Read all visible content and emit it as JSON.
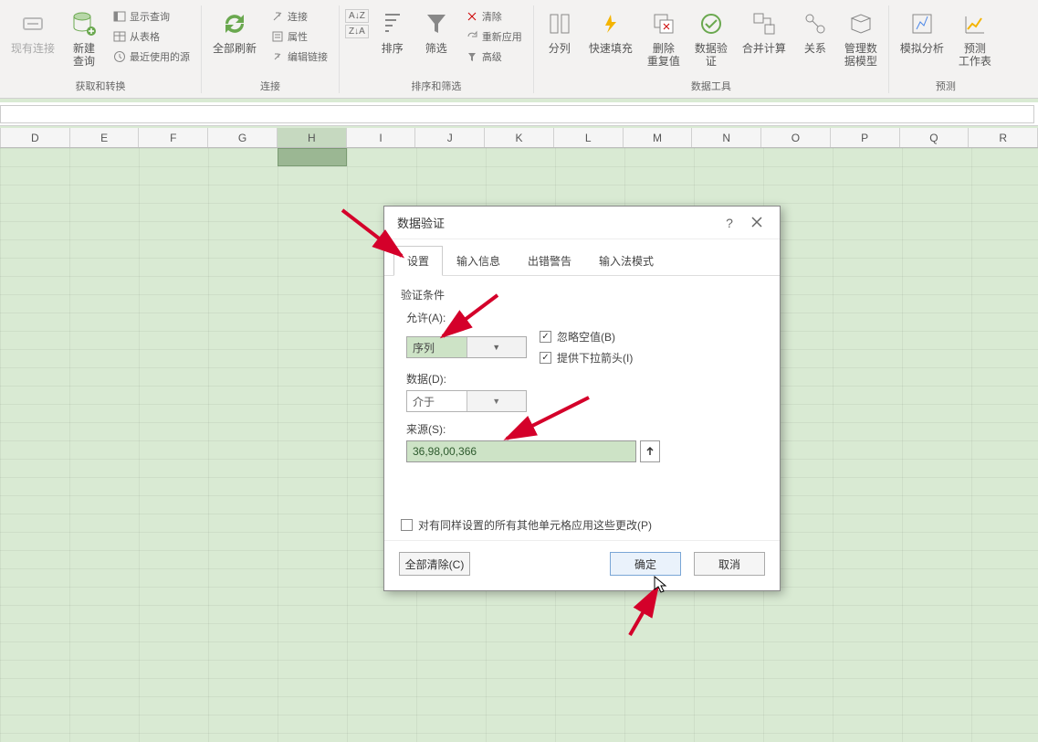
{
  "ribbon": {
    "btn_existing_conn": "现有连接",
    "btn_new_query": "新建\n查询",
    "small_show_query": "显示查询",
    "small_from_table": "从表格",
    "small_recent_sources": "最近使用的源",
    "group_get_transform": "获取和转换",
    "btn_refresh_all": "全部刷新",
    "small_connections": "连接",
    "small_properties": "属性",
    "small_edit_links": "编辑链接",
    "group_connections": "连接",
    "btn_sort_az": "A↓Z",
    "btn_sort_za": "Z↓A",
    "btn_sort": "排序",
    "btn_filter": "筛选",
    "small_clear": "清除",
    "small_reapply": "重新应用",
    "small_advanced": "高级",
    "group_sort_filter": "排序和筛选",
    "btn_text_to_columns": "分列",
    "btn_flash_fill": "快速填充",
    "btn_remove_dup": "删除\n重复值",
    "btn_data_validation": "数据验\n证",
    "btn_consolidate": "合并计算",
    "btn_relationships": "关系",
    "btn_manage_model": "管理数\n据模型",
    "group_data_tools": "数据工具",
    "btn_whatif": "模拟分析",
    "btn_forecast": "预测\n工作表",
    "group_forecast": "预测"
  },
  "columns": [
    "D",
    "E",
    "F",
    "G",
    "H",
    "I",
    "J",
    "K",
    "L",
    "M",
    "N",
    "O",
    "P",
    "Q",
    "R"
  ],
  "selected_column": "H",
  "dialog": {
    "title": "数据验证",
    "help_char": "?",
    "tabs": {
      "settings": "设置",
      "input_msg": "输入信息",
      "error_alert": "出错警告",
      "ime_mode": "输入法模式"
    },
    "section_label": "验证条件",
    "allow_label": "允许(A):",
    "allow_value": "序列",
    "data_label": "数据(D):",
    "data_value": "介于",
    "ignore_blank": "忽略空值(B)",
    "in_cell_dropdown": "提供下拉箭头(I)",
    "source_label": "来源(S):",
    "source_value": "36,98,00,366",
    "apply_all": "对有同样设置的所有其他单元格应用这些更改(P)",
    "btn_clear_all": "全部清除(C)",
    "btn_ok": "确定",
    "btn_cancel": "取消"
  }
}
